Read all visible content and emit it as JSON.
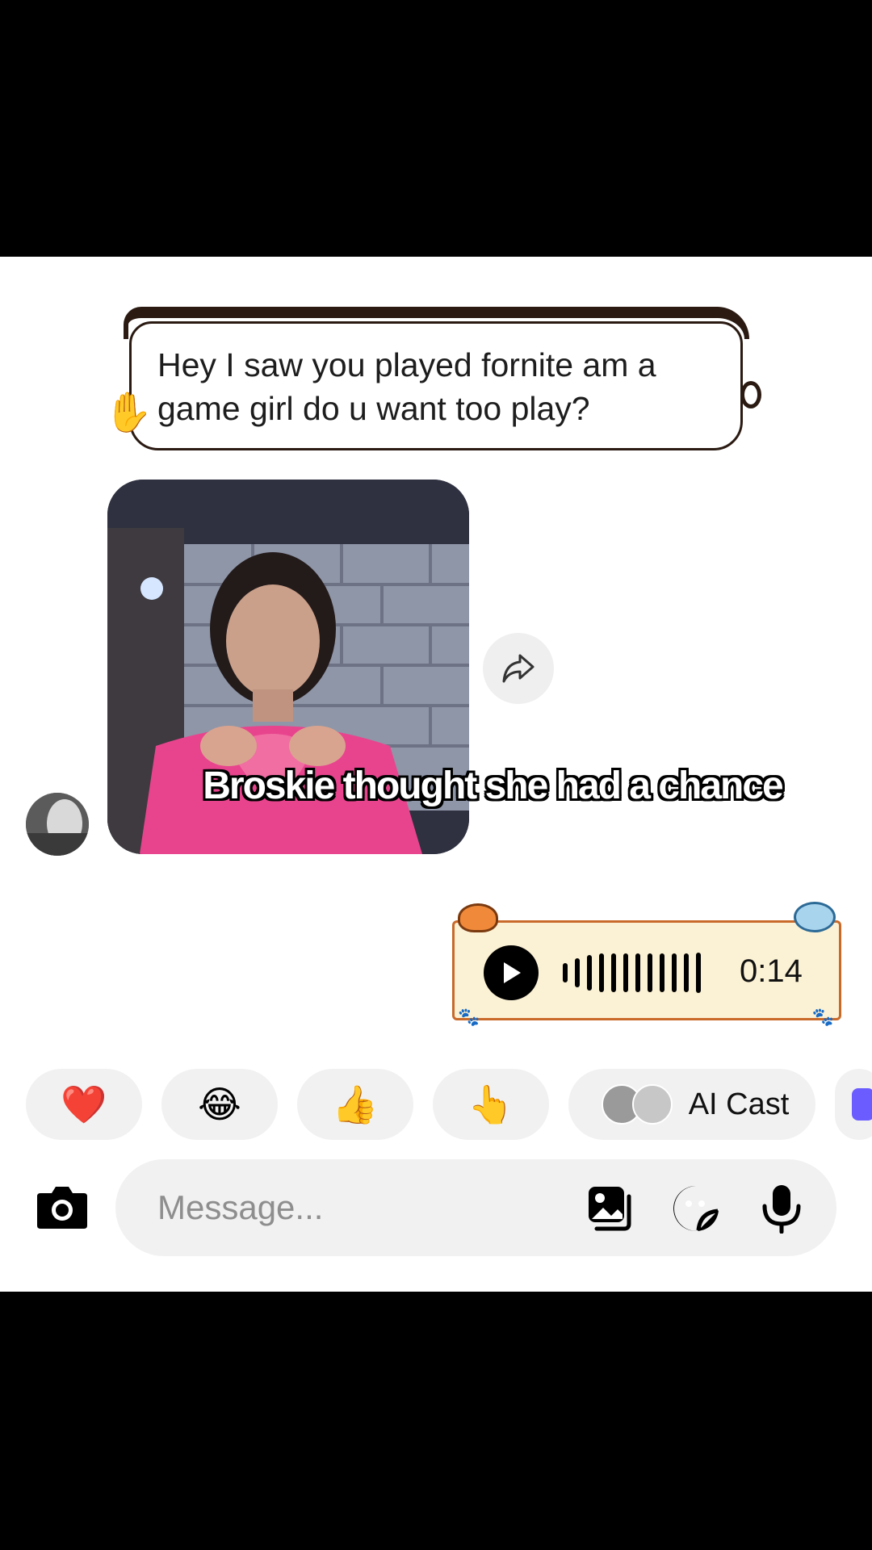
{
  "message_in": {
    "text": "Hey I saw you played fornite am a game girl do u want too play?"
  },
  "overlay_caption": "Broskie thought she had a chance",
  "voice_message": {
    "duration": "0:14"
  },
  "quick_reactions": [
    {
      "emoji": "❤️",
      "icon": "heart-icon"
    },
    {
      "emoji": "😂",
      "icon": "laughing-icon"
    },
    {
      "emoji": "👍",
      "icon": "thumbs-up-icon"
    },
    {
      "emoji": "👆",
      "icon": "pointing-up-icon"
    }
  ],
  "ai_cast_label": "AI Cast",
  "composer": {
    "placeholder": "Message..."
  },
  "colors": {
    "bubble_stroke": "#2a1a12",
    "voice_bg": "#fbf1d4",
    "voice_border": "#c96a2a"
  }
}
